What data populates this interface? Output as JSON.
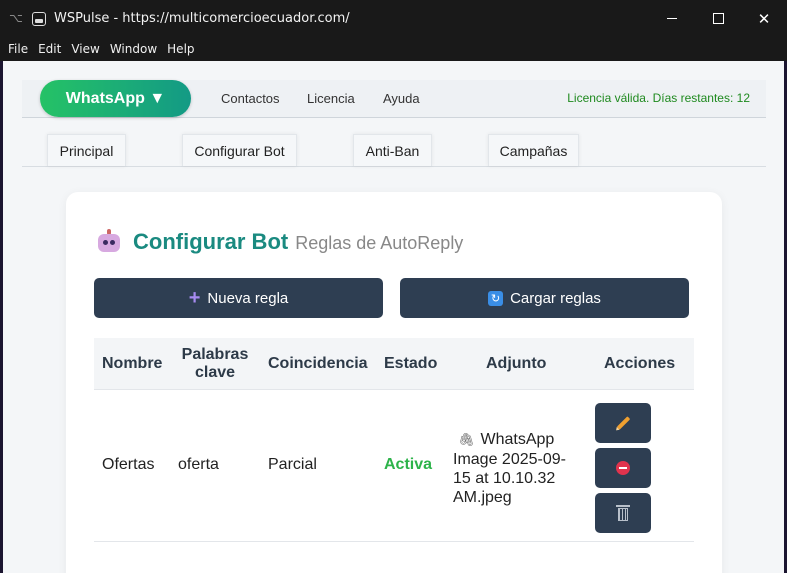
{
  "window": {
    "devtools_glyph": "⌥",
    "title": "WSPulse - https://multicomercioecuador.com/",
    "controls": {
      "close": "✕"
    }
  },
  "menu": [
    "File",
    "Edit",
    "View",
    "Window",
    "Help"
  ],
  "topnav": {
    "whatsapp_label": "WhatsApp ▼",
    "links": [
      "Contactos",
      "Licencia",
      "Ayuda"
    ],
    "license_status": "Licencia válida. Días restantes: 12",
    "accent": "#25c266",
    "license_color": "#1f8a1f"
  },
  "tabs": [
    "Principal",
    "Configurar Bot",
    "Anti-Ban",
    "Campañas"
  ],
  "card": {
    "icon": "robot-icon",
    "title": "Configurar Bot",
    "subtitle": "Reglas de AutoReply",
    "title_color": "#1a8a80",
    "buttons": {
      "new_rule": "Nueva regla",
      "load_rules": "Cargar reglas",
      "new_rule_icon": "plus-icon",
      "load_rules_icon": "reload-icon",
      "reload_glyph": "↻"
    }
  },
  "table": {
    "headers": [
      "Nombre",
      "Palabras clave",
      "Coincidencia",
      "Estado",
      "Adjunto",
      "Acciones"
    ],
    "rows": [
      {
        "name": "Ofertas",
        "keywords": "oferta",
        "match": "Parcial",
        "status": "Activa",
        "attachment": "WhatsApp Image 2025-09-15 at 10.10.32 AM.jpeg",
        "attachment_icon": "paperclip-icon",
        "clip_glyph": "🖇",
        "actions": [
          "edit-icon",
          "disable-icon",
          "trash-icon"
        ]
      }
    ],
    "status_color": "#2db34a"
  }
}
